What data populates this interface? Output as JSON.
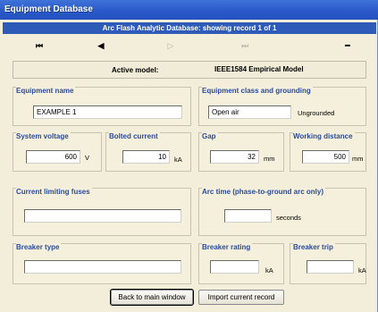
{
  "window": {
    "title": "Equipment Database"
  },
  "header": {
    "text": "Arc Flash Analytic Database: showing record 1 of 1"
  },
  "nav": {
    "first": "⏮",
    "prev": "◀",
    "next": "▷",
    "last": "⏭",
    "delete": "━"
  },
  "model": {
    "label": "Active model:",
    "value": "IEEE1584 Empirical Model"
  },
  "equipment_name": {
    "label": "Equipment name",
    "value": "EXAMPLE 1"
  },
  "equipment_class": {
    "label": "Equipment class and grounding",
    "value": "Open air",
    "grounding": "Ungrounded"
  },
  "system_voltage": {
    "label": "System voltage",
    "value": "600",
    "unit": "V"
  },
  "bolted_current": {
    "label": "Bolted current",
    "value": "10",
    "unit": "kA"
  },
  "gap": {
    "label": "Gap",
    "value": "32",
    "unit": "mm"
  },
  "working_distance": {
    "label": "Working distance",
    "value": "500",
    "unit": "mm"
  },
  "fuses": {
    "label": "Current limiting fuses",
    "value": ""
  },
  "arc_time": {
    "label": "Arc time (phase-to-ground arc only)",
    "value": "",
    "unit": "seconds"
  },
  "breaker_type": {
    "label": "Breaker type",
    "value": ""
  },
  "breaker_rating": {
    "label": "Breaker rating",
    "value": "",
    "unit": "kA"
  },
  "breaker_trip": {
    "label": "Breaker trip",
    "value": "",
    "unit": "kA"
  },
  "buttons": {
    "back": "Back to main window",
    "import": "Import current record"
  }
}
